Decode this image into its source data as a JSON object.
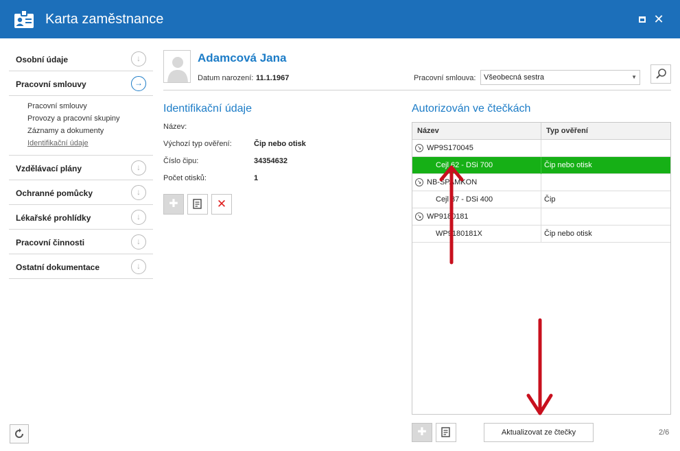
{
  "window": {
    "title": "Karta zaměstnance",
    "icon": "id-card-icon"
  },
  "sidebar": {
    "sections": [
      {
        "label": "Osobní údaje",
        "icon": "arrow-down-circle-icon"
      },
      {
        "label": "Pracovní smlouvy",
        "icon": "arrow-right-circle-icon",
        "active": true,
        "subitems": [
          "Pracovní smlouvy",
          "Provozy a pracovní skupiny",
          "Záznamy a dokumenty",
          "Identifikační údaje"
        ],
        "current_subitem": "Identifikační údaje"
      },
      {
        "label": "Vzdělávací plány",
        "icon": "arrow-down-circle-icon"
      },
      {
        "label": "Ochranné pomůcky",
        "icon": "arrow-down-circle-icon"
      },
      {
        "label": "Lékařské prohlídky",
        "icon": "arrow-down-circle-icon"
      },
      {
        "label": "Pracovní činnosti",
        "icon": "arrow-down-circle-icon"
      },
      {
        "label": "Ostatní dokumentace",
        "icon": "arrow-down-circle-icon"
      }
    ]
  },
  "employee": {
    "name": "Adamcová Jana",
    "dob_label": "Datum narození:",
    "dob": "11.1.1967",
    "contract_label": "Pracovní smlouva:",
    "contract_value": "Všeobecná sestra"
  },
  "identification": {
    "title": "Identifikační údaje",
    "fields": [
      {
        "label": "Název:",
        "value": ""
      },
      {
        "label": "Výchozí typ ověření:",
        "value": "Čip nebo otisk"
      },
      {
        "label": "Číslo čipu:",
        "value": "34354632"
      },
      {
        "label": "Počet otisků:",
        "value": "1"
      }
    ]
  },
  "readers": {
    "title": "Autorizován ve čtečkách",
    "columns": [
      "Název",
      "Typ ověření"
    ],
    "rows": [
      {
        "kind": "group",
        "name": "WP9S170045",
        "type": ""
      },
      {
        "kind": "child",
        "name": "Cejl 62 - DSi 700",
        "type": "Čip nebo otisk",
        "selected": true
      },
      {
        "kind": "group",
        "name": "NB-SPAMKON",
        "type": ""
      },
      {
        "kind": "child",
        "name": "Cejl 37 - DSi 400",
        "type": "Čip"
      },
      {
        "kind": "group",
        "name": "WP9180181",
        "type": ""
      },
      {
        "kind": "child",
        "name": "WP9180181X",
        "type": "Čip nebo otisk"
      }
    ],
    "update_button": "Aktualizovat ze čtečky",
    "page": "2/6"
  },
  "colors": {
    "titlebar": "#1c6fba",
    "accent": "#1c7cc7",
    "selected_row": "#16b016",
    "annotation_arrow": "#c8101e"
  }
}
